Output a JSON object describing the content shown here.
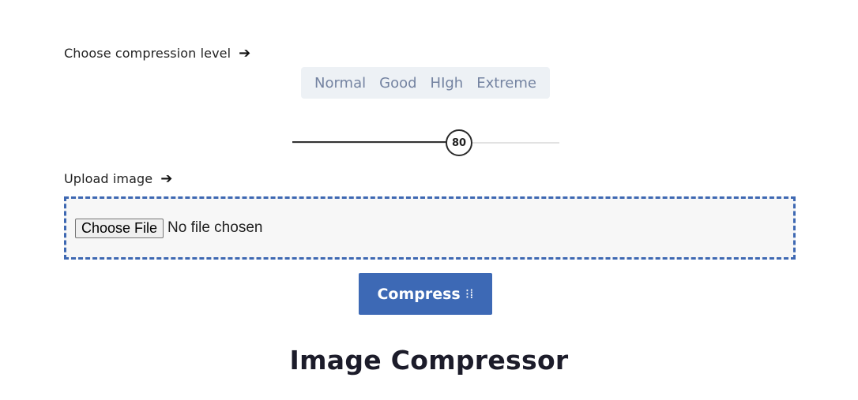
{
  "compression": {
    "label": "Choose compression level",
    "arrow": "➔",
    "levels": [
      "Normal",
      "Good",
      "HIgh",
      "Extreme"
    ]
  },
  "slider": {
    "value": "80",
    "min": 0,
    "max": 100
  },
  "upload": {
    "label": "Upload image",
    "arrow": "➔",
    "button_label": "Choose File",
    "status": "No file chosen"
  },
  "compress_button": {
    "label": "Compress",
    "icon": "⁝⁞"
  },
  "heading": "Image Compressor",
  "colors": {
    "accent": "#3d69b5",
    "dropzone_border": "#3e68b2",
    "level_text": "#7483a1",
    "level_bg": "#edf1f5"
  }
}
